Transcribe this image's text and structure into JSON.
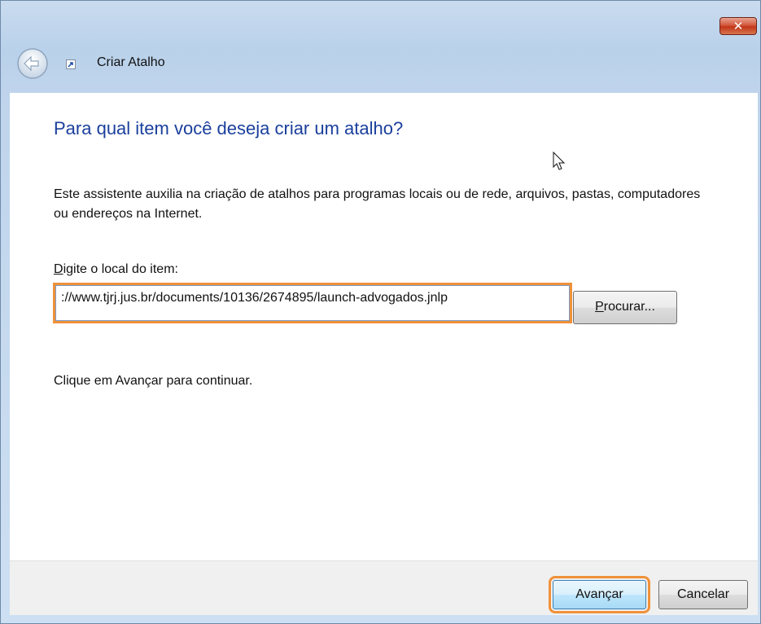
{
  "window": {
    "title": "Criar Atalho",
    "close_label": "✕"
  },
  "main": {
    "heading": "Para qual item você deseja criar um atalho?",
    "description": "Este assistente auxilia na criação de atalhos para programas locais ou de rede, arquivos, pastas, computadores ou endereços na Internet.",
    "field_label_accesskey": "D",
    "field_label_rest": "igite o local do item:",
    "location_value": "://www.tjrj.jus.br/documents/10136/2674895/launch-advogados.jnlp",
    "browse_accesskey": "P",
    "browse_rest": "rocurar...",
    "hint": "Clique em Avançar para continuar."
  },
  "footer": {
    "next_label": "Avançar",
    "cancel_label": "Cancelar"
  },
  "colors": {
    "heading": "#1a3f9c",
    "highlight": "#f0913a"
  },
  "icons": [
    "back-arrow-icon",
    "shortcut-icon",
    "close-icon",
    "mouse-cursor-icon"
  ]
}
